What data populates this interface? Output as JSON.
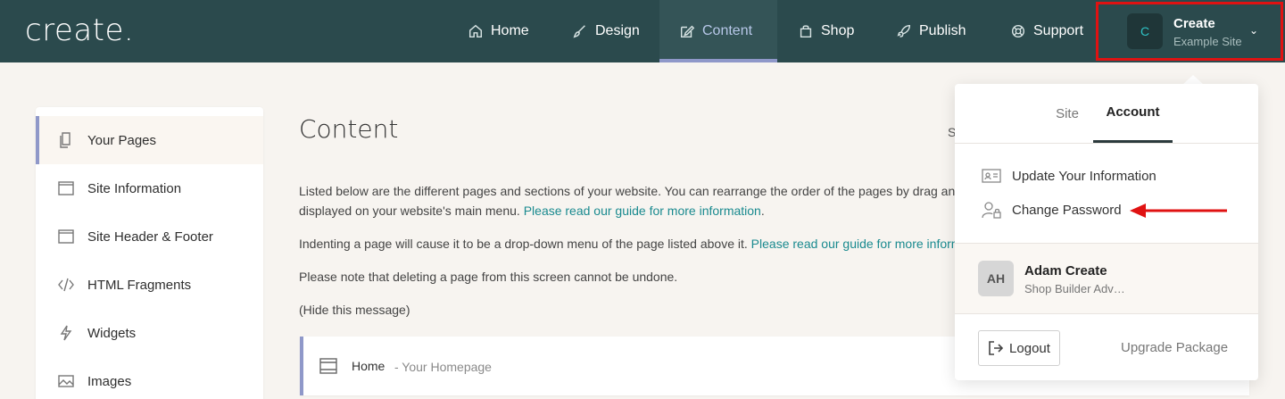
{
  "brand": {
    "logo_text": "create."
  },
  "nav": {
    "items": [
      {
        "label": "Home",
        "icon": "home-icon"
      },
      {
        "label": "Design",
        "icon": "brush-icon"
      },
      {
        "label": "Content",
        "icon": "edit-icon",
        "active": true
      },
      {
        "label": "Shop",
        "icon": "bag-icon"
      },
      {
        "label": "Publish",
        "icon": "rocket-icon"
      },
      {
        "label": "Support",
        "icon": "lifebuoy-icon"
      }
    ],
    "account": {
      "avatar_initial": "C",
      "name": "Create",
      "site": "Example Site"
    }
  },
  "sidebar": {
    "items": [
      {
        "label": "Your Pages",
        "icon": "pages-icon",
        "active": true
      },
      {
        "label": "Site Information",
        "icon": "window-icon"
      },
      {
        "label": "Site Header & Footer",
        "icon": "window-icon"
      },
      {
        "label": "HTML Fragments",
        "icon": "code-icon"
      },
      {
        "label": "Widgets",
        "icon": "lightning-icon"
      },
      {
        "label": "Images",
        "icon": "image-icon"
      }
    ]
  },
  "main": {
    "title": "Content",
    "cut_text": "S",
    "para1_line1": "Listed below are the different pages and sections of your website. You can rearrange the order of the pages by drag and",
    "para1_line2": "displayed on your website's main menu. ",
    "para1_link": "Please read our guide for more information",
    "para1_tail": ".",
    "para2": "Indenting a page will cause it to be a drop-down menu of the page listed above it. ",
    "para2_link": "Please read our guide for more inform",
    "para3": "Please note that deleting a page from this screen cannot be undone.",
    "hide_message": "(Hide this message)",
    "page_row": {
      "name": "Home",
      "subtitle": "- Your Homepage"
    }
  },
  "dropdown": {
    "tabs": {
      "site": "Site",
      "account": "Account"
    },
    "update_info": "Update Your Information",
    "change_password": "Change Password",
    "user": {
      "initials": "AH",
      "name": "Adam Create",
      "role": "Shop Builder Adv…"
    },
    "logout": "Logout",
    "upgrade": "Upgrade Package"
  },
  "colors": {
    "topbar": "#2b4a4d",
    "accent": "#8f98c9",
    "link": "#1a8a8f",
    "highlight_box": "#e01212"
  }
}
